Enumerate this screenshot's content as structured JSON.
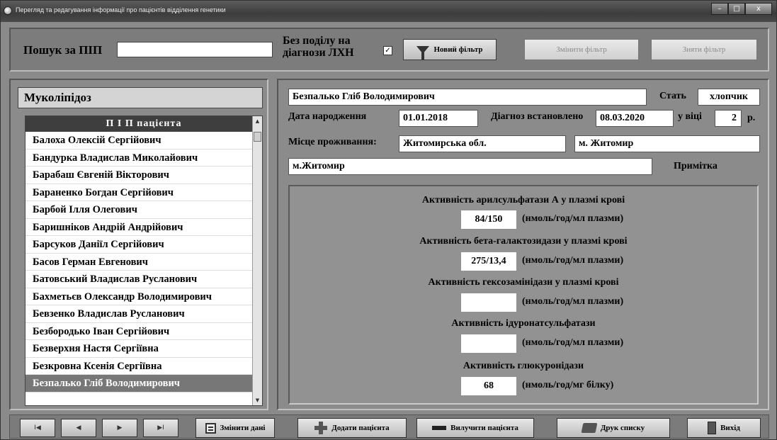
{
  "window": {
    "title": "Перегляд та редагування інформації про пацієнтів відділення генетики",
    "controls": {
      "minimize": "–",
      "maximize": "□",
      "close": "x"
    }
  },
  "filter": {
    "search_label": "Пошук за ПІП",
    "search_value": "",
    "diag_label_line1": "Без поділу на",
    "diag_label_line2": "діагнози ЛХН",
    "checkbox_checked": true,
    "checkbox_mark": "✓",
    "new_filter": "Новий фільтр",
    "change_filter": "Змінити фільтр",
    "remove_filter": "Зняти фільтр"
  },
  "list_panel": {
    "group_title": "Муколіпідоз",
    "column_header": "П І П   пацієнта",
    "patients": [
      "Балоха Олексій Сергійович",
      "Бандурка Владислав Миколайович",
      "Барабаш Євгеній Вікторович",
      "Бараненко Богдан Сергійович",
      "Барбой Ілля Олегович",
      "Баришніков Андрій Андрійович",
      "Барсуков Даніїл Сергійович",
      "Басов  Герман  Евгенович",
      "Батовський Владислав Русланович",
      "Бахметьєв Олександр Володимирович",
      "Бевзенко Владислав Русланович",
      "Безбородько Іван Сергійович",
      "Безверхня Настя Сергіївна",
      "Безкровна Ксенія Сергіївна",
      "Безпалько Гліб Володимирович"
    ],
    "selected_index": 14,
    "scroll_up": "▲",
    "scroll_down": "▼"
  },
  "patient": {
    "full_name": "Безпалько Гліб Володимирович",
    "sex_label": "Стать",
    "sex_value": "хлопчик",
    "birth_label": "Дата народження",
    "birth_value": "01.01.2018",
    "diag_date_label": "Діагноз встановлено",
    "diag_date_value": "08.03.2020",
    "age_label": "у віці",
    "age_value": "2",
    "age_unit": "р.",
    "residence_label": "Місце проживання:",
    "region": "Житомирська обл.",
    "city": "м. Житомир",
    "address": "м.Житомир",
    "note_label": "Примітка"
  },
  "tests": [
    {
      "title": "Активність арилсульфатази А у плазмі крові",
      "value": "84/150",
      "unit": "(нмоль/год/мл плазми)"
    },
    {
      "title": "Активність бета-галактозидази у плазмі крові",
      "value": "275/13,4",
      "unit": "(нмоль/год/мл плазми)"
    },
    {
      "title": "Активність гексозамінідази у плазмі крові",
      "value": "",
      "unit": "(нмоль/год/мл плазми)"
    },
    {
      "title": "Активність ідуронатсульфатази",
      "value": "",
      "unit": "(нмоль/год/мл плазми)"
    },
    {
      "title": "Активність глюкуронідази",
      "value": "68",
      "unit": "(нмоль/год/мг білку)"
    }
  ],
  "toolbar": {
    "nav_first": "I◀",
    "nav_prev": "◀",
    "nav_next": "▶",
    "nav_last": "▶I",
    "edit": "Змінити дані",
    "add": "Додати пацієнта",
    "remove": "Вилучити пацієнта",
    "print": "Друк списку",
    "exit": "Вихід"
  }
}
